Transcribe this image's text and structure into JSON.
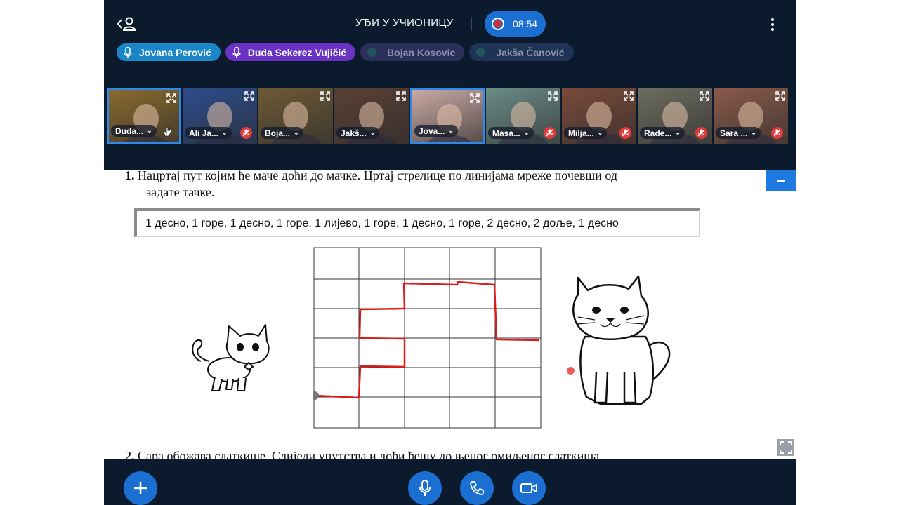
{
  "header": {
    "title": "УЂИ У УЧИОНИЦУ",
    "recording_time": "08:54"
  },
  "speakers": [
    {
      "name": "Jovana Perović",
      "state": "speaking",
      "color": "#1a86c7"
    },
    {
      "name": "Duda Sekerez Vujičić",
      "state": "speaking",
      "color": "#6b33c4"
    },
    {
      "name": "Bojan Kosovic",
      "state": "idle",
      "color": "#2a2f5c"
    },
    {
      "name": "Jakša Čanović",
      "state": "idle",
      "color": "#1f3356"
    }
  ],
  "participants": [
    {
      "label": "Duda...",
      "bg": "#8a6a2e",
      "active": true,
      "status": "hand"
    },
    {
      "label": "Ali Ja...",
      "bg": "#2d4c8c",
      "active": false,
      "status": "muted"
    },
    {
      "label": "Boja...",
      "bg": "#6e5a36",
      "active": false,
      "status": "none"
    },
    {
      "label": "Jakš...",
      "bg": "#5a4036",
      "active": false,
      "status": "none"
    },
    {
      "label": "Jova...",
      "bg": "#c9a9a4",
      "active": true,
      "status": "none"
    },
    {
      "label": "Masa...",
      "bg": "#6a8c86",
      "active": false,
      "status": "muted"
    },
    {
      "label": "Milja...",
      "bg": "#7a4a3a",
      "active": false,
      "status": "muted"
    },
    {
      "label": "Rade...",
      "bg": "#6c6c60",
      "active": false,
      "status": "muted"
    },
    {
      "label": "Sara ...",
      "bg": "#8a5a4a",
      "active": false,
      "status": "muted"
    }
  ],
  "worksheet": {
    "task1_number": "1.",
    "task1_line1": "Нацртај пут којим ће маче доћи до мачке. Цртај стрелице по линијама мреже почевши од",
    "task1_line2": "задате тачке.",
    "instructions": "1 десно,  1 горе,  1 десно,  1 горе,  1 лијево,  1 горе,  1 десно,  1 горе,  2 десно,  2 доље,  1 десно",
    "task2_number": "2.",
    "task2_text": "Сара обожава слаткише. Слиједи упутства и дођи ђешу до њеног омиљеног слаткиша."
  },
  "colors": {
    "bar_bg": "#0c1a2e",
    "accent": "#1b6fd1",
    "path_red": "#d91c1c"
  },
  "icons": {
    "back": "back-user-icon",
    "more": "more-vertical-icon",
    "record": "record-icon",
    "add": "plus-icon",
    "mic": "microphone-icon",
    "call": "phone-icon",
    "video": "video-camera-icon"
  }
}
